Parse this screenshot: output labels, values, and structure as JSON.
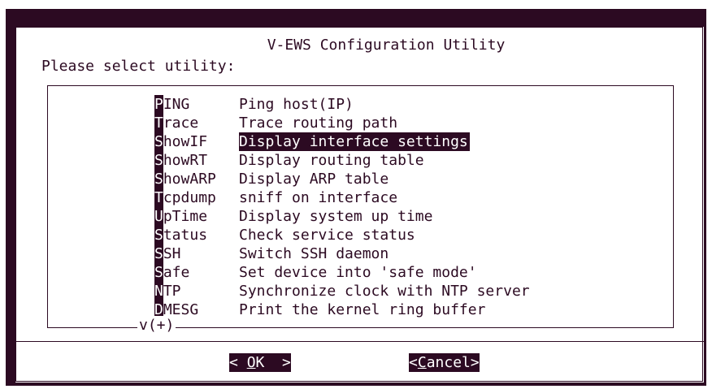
{
  "dialog": {
    "title": "V-EWS Configuration Utility",
    "prompt": "Please select utility:",
    "more_indicator": "v(+)"
  },
  "items": [
    {
      "hotkey": "P",
      "rest": "ING",
      "desc": "Ping host(IP)",
      "selected": false
    },
    {
      "hotkey": "T",
      "rest": "race",
      "desc": "Trace routing path",
      "selected": false
    },
    {
      "hotkey": "S",
      "rest": "howIF",
      "desc": "Display interface settings",
      "selected": true
    },
    {
      "hotkey": "S",
      "rest": "howRT",
      "desc": "Display routing table",
      "selected": false
    },
    {
      "hotkey": "S",
      "rest": "howARP",
      "desc": "Display ARP table",
      "selected": false
    },
    {
      "hotkey": "T",
      "rest": "cpdump",
      "desc": "sniff on interface",
      "selected": false
    },
    {
      "hotkey": "U",
      "rest": "pTime",
      "desc": "Display system up time",
      "selected": false
    },
    {
      "hotkey": "S",
      "rest": "tatus",
      "desc": "Check service status",
      "selected": false
    },
    {
      "hotkey": "S",
      "rest": "SH",
      "desc": "Switch SSH daemon",
      "selected": false
    },
    {
      "hotkey": "S",
      "rest": "afe",
      "desc": "Set device into 'safe mode'",
      "selected": false
    },
    {
      "hotkey": "N",
      "rest": "TP",
      "desc": "Synchronize clock with NTP server",
      "selected": false
    },
    {
      "hotkey": "D",
      "rest": "MESG",
      "desc": "Print the kernel ring buffer",
      "selected": false
    }
  ],
  "buttons": {
    "ok_left": "< ",
    "ok_hot": "O",
    "ok_rest": "K  >",
    "cancel_left": "<",
    "cancel_hot": "C",
    "cancel_rest": "ancel>"
  },
  "colors": {
    "terminal_bg": "#2c0a22",
    "dialog_bg": "#ffffff"
  }
}
